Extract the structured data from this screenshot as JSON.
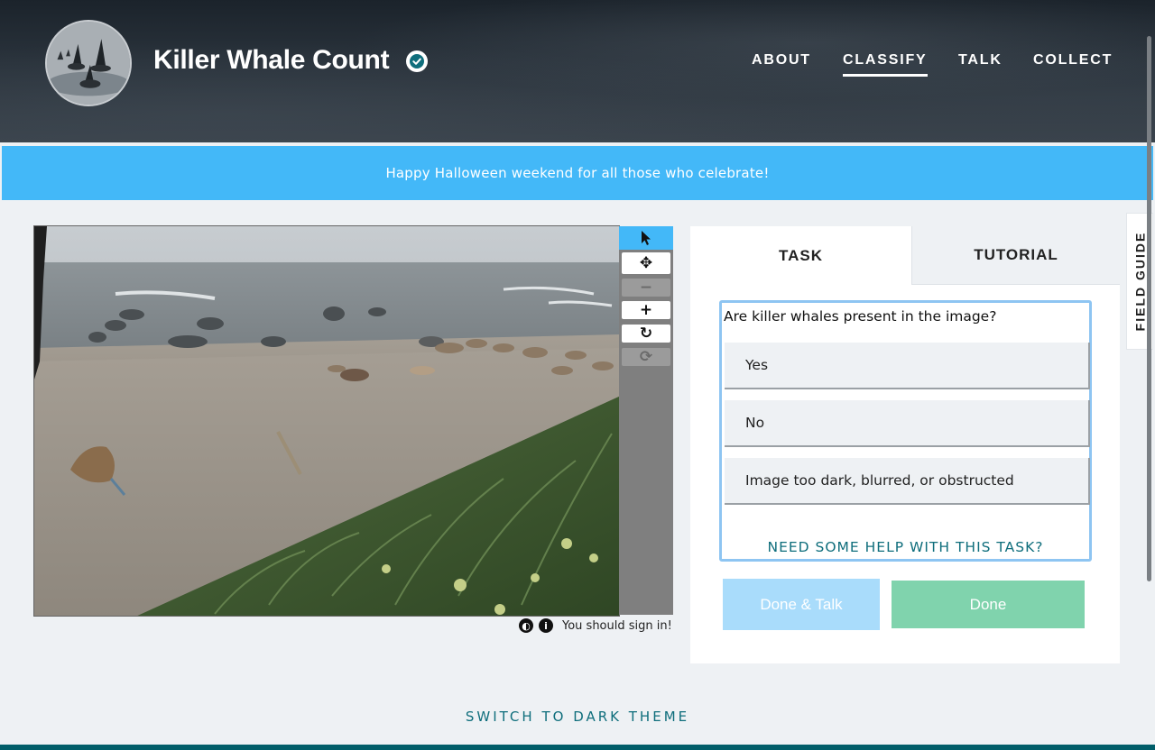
{
  "header": {
    "project_title": "Killer Whale Count",
    "nav": [
      {
        "label": "ABOUT",
        "active": false
      },
      {
        "label": "CLASSIFY",
        "active": true
      },
      {
        "label": "TALK",
        "active": false
      },
      {
        "label": "COLLECT",
        "active": false
      }
    ]
  },
  "banner": {
    "message": "Happy Halloween weekend for all those who celebrate!"
  },
  "toolbar": {
    "tools": [
      "pointer-icon",
      "move-icon",
      "zoom-out-icon",
      "zoom-in-icon",
      "rotate-icon",
      "reset-icon"
    ],
    "active_tool": "pointer-icon"
  },
  "viewer_meta": {
    "sign_in": "You should sign in!",
    "icons": [
      "contrast-icon",
      "info-icon"
    ]
  },
  "task_panel": {
    "tabs": {
      "task": "TASK",
      "tutorial": "TUTORIAL"
    },
    "question": "Are killer whales present in the image?",
    "answers": [
      "Yes",
      "No",
      "Image too dark, blurred, or obstructed"
    ],
    "help_link": "NEED SOME HELP WITH THIS TASK?",
    "done_talk": "Done & Talk",
    "done": "Done"
  },
  "field_guide": {
    "label": "FIELD GUIDE"
  },
  "theme_toggle": {
    "label": "SWITCH TO DARK THEME"
  },
  "colors": {
    "banner": "#43b8f8",
    "done": "#80d3ad",
    "done_talk": "#a9dcfb",
    "link": "#0f6e7c",
    "footer": "#005d69"
  }
}
